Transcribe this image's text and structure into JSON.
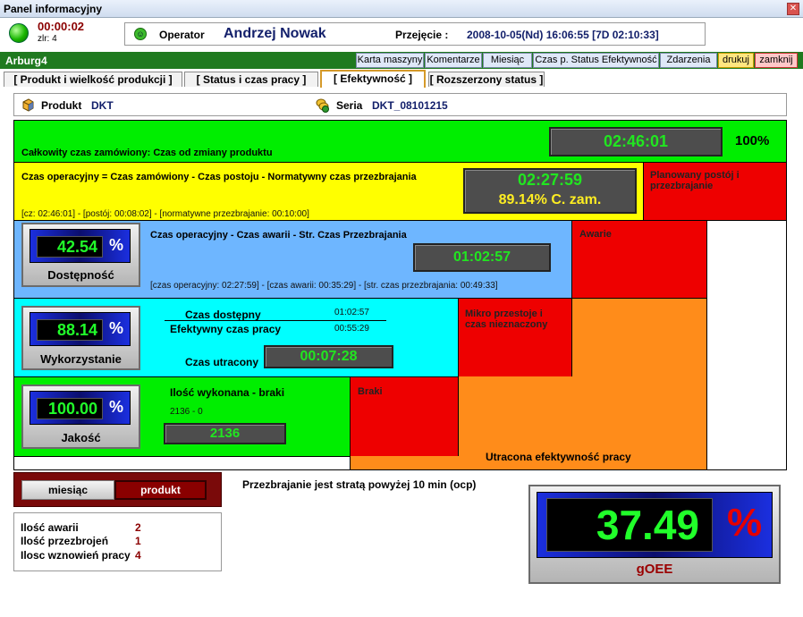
{
  "window": {
    "title": "Panel informacyjny",
    "close_label": "✕"
  },
  "header": {
    "timer": "00:00:02",
    "zlr": "zlr: 4",
    "operator_label": "Operator",
    "operator_name": "Andrzej Nowak",
    "przejecie_label": "Przejęcie :",
    "przejecie_value": "2008-10-05(Nd) 16:06:55 [7D 02:10:33]"
  },
  "machine": {
    "name": "Arburg4"
  },
  "nav": {
    "karta": "Karta maszyny",
    "komentarze": "Komentarze",
    "miesiac": "Miesiąc",
    "czas_status": "Czas p. Status Efektywność",
    "zdarzenia": "Zdarzenia",
    "drukuj": "drukuj",
    "zamknij": "zamknij"
  },
  "tabs": {
    "produkt": "[ Produkt i wielkość produkcji ]",
    "status": "[ Status i czas pracy ]",
    "efektywnosc": "[ Efektywność ]",
    "rozszerzony": "[ Rozszerzony status ]"
  },
  "product": {
    "produkt_label": "Produkt",
    "produkt_value": "DKT",
    "seria_label": "Seria",
    "seria_value": "DKT_08101215"
  },
  "blocks": {
    "total": {
      "label": "Całkowity czas zamówiony: Czas od zmiany produktu",
      "time": "02:46:01",
      "pct": "100%"
    },
    "operational": {
      "label": "Czas operacyjny = Czas zamówiony - Czas postoju - Normatywny czas przezbrajania",
      "time": "02:27:59",
      "pct": "89.14% C. zam.",
      "detail": "[cz: 02:46:01] - [postój: 00:08:02] - [normatywne przezbrajanie: 00:10:00]"
    },
    "planned": {
      "label": "Planowany postój i przezbrajanie"
    },
    "availability": {
      "label": "Czas operacyjny - Czas awarii - Str. Czas Przezbrajania",
      "time": "01:02:57",
      "detail": "[czas operacyjny: 02:27:59] - [czas awarii: 00:35:29] - [str. czas przezbrajania: 00:49:33]"
    },
    "awarie": {
      "label": "Awarie"
    },
    "utilization": {
      "czas_dostepny_label": "Czas dostępny",
      "czas_dostepny_value": "01:02:57",
      "efektywny_label": "Efektywny czas pracy",
      "efektywny_value": "00:55:29",
      "utracony_label": "Czas utracony",
      "utracony_value": "00:07:28"
    },
    "mikro": {
      "label": "Mikro przestoje i czas nieznaczony"
    },
    "quality": {
      "label": "Ilość wykonana - braki",
      "detail": "2136 - 0",
      "value": "2136"
    },
    "braki": {
      "label": "Braki"
    },
    "utracona": {
      "label": "Utracona efektywność pracy"
    }
  },
  "gauges": {
    "dostepnosc": {
      "value": "42.54",
      "pct": "%",
      "caption": "Dostępność"
    },
    "wykorzystanie": {
      "value": "88.14",
      "pct": "%",
      "caption": "Wykorzystanie"
    },
    "jakosc": {
      "value": "100.00",
      "pct": "%",
      "caption": "Jakość"
    },
    "goee": {
      "value": "37.49",
      "pct": "%",
      "caption": "gOEE"
    }
  },
  "mode": {
    "miesiac": "miesiąc",
    "produkt": "produkt"
  },
  "note": "Przezbrajanie  jest stratą powyżej 10 min (ocp)",
  "legend": {
    "awarii_label": "Ilość awarii",
    "awarii_value": "2",
    "przezbrojen_label": "Ilość przezbrojeń",
    "przezbrojen_value": "1",
    "wznowien_label": "Ilosc wznowień pracy",
    "wznowien_value": "4"
  },
  "colors": {
    "green": "#00ee00",
    "yellow": "#ffff00",
    "red": "#ee0000",
    "blue": "#6eb6ff",
    "cyan": "#00ffff",
    "orange": "#ff8c1a"
  }
}
